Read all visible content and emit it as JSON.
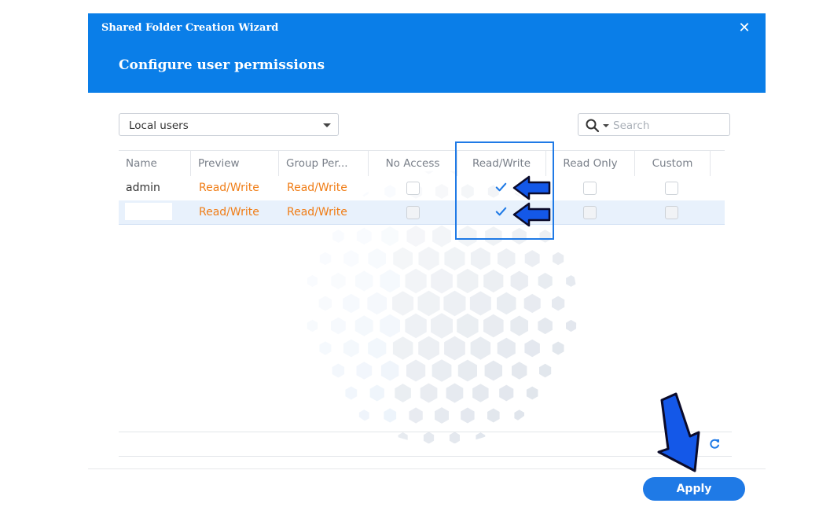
{
  "wizard": {
    "title": "Shared Folder Creation Wizard",
    "step_title": "Configure user permissions",
    "close_icon": "close-icon"
  },
  "filter": {
    "dropdown_value": "Local users",
    "search_placeholder": "Search"
  },
  "table": {
    "columns": [
      "Name",
      "Preview",
      "Group Per...",
      "No Access",
      "Read/Write",
      "Read Only",
      "Custom"
    ],
    "rows": [
      {
        "name": "admin",
        "preview": "Read/Write",
        "group_permission": "Read/Write",
        "no_access": false,
        "read_write": true,
        "read_only": false,
        "custom": false,
        "selected": false
      },
      {
        "name": "",
        "preview": "Read/Write",
        "group_permission": "Read/Write",
        "no_access": false,
        "read_write": true,
        "read_only": false,
        "custom": false,
        "selected": true
      }
    ]
  },
  "footer": {
    "apply_label": "Apply",
    "refresh_icon": "refresh-icon"
  },
  "colors": {
    "header_bg": "#0a7ee8",
    "accent": "#1f7ae6",
    "permission_text": "#f07d16",
    "annotation_arrow": "#1458e8"
  }
}
